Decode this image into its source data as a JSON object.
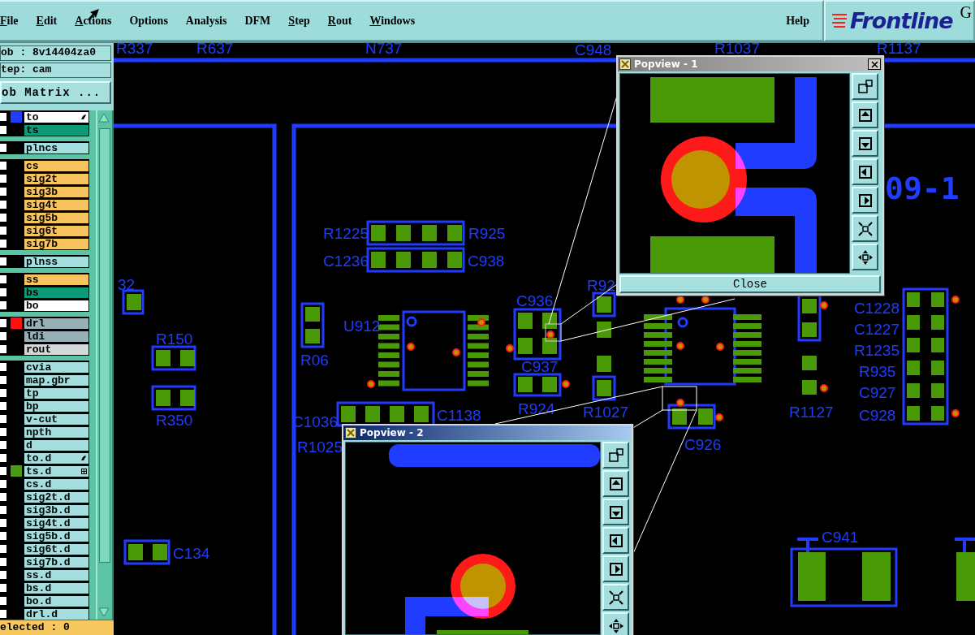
{
  "menu": {
    "items": [
      {
        "label": "File",
        "underlined": true
      },
      {
        "label": "Edit",
        "underlined": true
      },
      {
        "label": "Actions",
        "underlined": true
      },
      {
        "label": "Options",
        "underlined": false
      },
      {
        "label": "Analysis",
        "underlined": false
      },
      {
        "label": "DFM",
        "underlined": false
      },
      {
        "label": "Step",
        "underlined": true
      },
      {
        "label": "Rout",
        "underlined": true
      },
      {
        "label": "Windows",
        "underlined": true
      }
    ],
    "help": "Help"
  },
  "logo": {
    "name": "Frontline",
    "suffix": "G"
  },
  "job_panel": {
    "job": "ob : 8v14404za0",
    "step": "tep: cam",
    "matrix_button": "ob Matrix ...",
    "layer_groups": [
      [
        {
          "name": "to",
          "kind": "silk",
          "color": "#1f3cff",
          "pointer": true,
          "grid": false,
          "checked": false
        },
        {
          "name": "ts",
          "kind": "mask",
          "pointer": false,
          "grid": false,
          "checked": false
        }
      ],
      [
        {
          "name": "plncs",
          "kind": "plane",
          "pointer": false,
          "grid": false,
          "checked": false
        }
      ],
      [
        {
          "name": "cs",
          "kind": "signal",
          "pointer": false,
          "grid": false,
          "checked": false
        },
        {
          "name": "sig2t",
          "kind": "signal",
          "pointer": false,
          "grid": false,
          "checked": false
        },
        {
          "name": "sig3b",
          "kind": "signal",
          "pointer": false,
          "grid": false,
          "checked": false
        },
        {
          "name": "sig4t",
          "kind": "signal",
          "pointer": false,
          "grid": false,
          "checked": false
        },
        {
          "name": "sig5b",
          "kind": "signal",
          "pointer": false,
          "grid": false,
          "checked": false
        },
        {
          "name": "sig6t",
          "kind": "signal",
          "pointer": false,
          "grid": false,
          "checked": false
        },
        {
          "name": "sig7b",
          "kind": "signal",
          "pointer": false,
          "grid": false,
          "checked": false
        }
      ],
      [
        {
          "name": "plnss",
          "kind": "plane",
          "pointer": false,
          "grid": false,
          "checked": false
        }
      ],
      [
        {
          "name": "ss",
          "kind": "signal",
          "pointer": false,
          "grid": false,
          "checked": false
        },
        {
          "name": "bs",
          "kind": "mask",
          "pointer": false,
          "grid": false,
          "checked": false
        },
        {
          "name": "bo",
          "kind": "silk",
          "pointer": false,
          "grid": false,
          "checked": false
        }
      ],
      [
        {
          "name": "drl",
          "kind": "drill",
          "color": "#ff1010",
          "pointer": false,
          "grid": false,
          "checked": false
        },
        {
          "name": "ldi",
          "kind": "drill",
          "pointer": false,
          "grid": false,
          "checked": false
        },
        {
          "name": "rout",
          "kind": "rout",
          "pointer": false,
          "grid": false,
          "checked": false
        }
      ],
      [
        {
          "name": "cvia",
          "kind": "document",
          "pointer": false,
          "grid": false,
          "checked": false
        },
        {
          "name": "map.gbr",
          "kind": "document",
          "pointer": false,
          "grid": false,
          "checked": false
        },
        {
          "name": "tp",
          "kind": "document",
          "pointer": false,
          "grid": false,
          "checked": false
        },
        {
          "name": "bp",
          "kind": "document",
          "pointer": false,
          "grid": false,
          "checked": false
        },
        {
          "name": "v-cut",
          "kind": "document",
          "pointer": false,
          "grid": false,
          "checked": false
        },
        {
          "name": "npth",
          "kind": "document",
          "pointer": false,
          "grid": false,
          "checked": false
        },
        {
          "name": "d",
          "kind": "document",
          "pointer": false,
          "grid": false,
          "checked": false
        },
        {
          "name": "to.d",
          "kind": "document",
          "pointer": true,
          "grid": false,
          "checked": false
        },
        {
          "name": "ts.d",
          "kind": "document",
          "color": "#4a9a10",
          "pointer": false,
          "grid": true,
          "checked": false
        },
        {
          "name": "cs.d",
          "kind": "document",
          "pointer": false,
          "grid": false,
          "checked": false
        },
        {
          "name": "sig2t.d",
          "kind": "document",
          "pointer": false,
          "grid": false,
          "checked": false
        },
        {
          "name": "sig3b.d",
          "kind": "document",
          "pointer": false,
          "grid": false,
          "checked": false
        },
        {
          "name": "sig4t.d",
          "kind": "document",
          "pointer": false,
          "grid": false,
          "checked": false
        },
        {
          "name": "sig5b.d",
          "kind": "document",
          "pointer": false,
          "grid": false,
          "checked": false
        },
        {
          "name": "sig6t.d",
          "kind": "document",
          "pointer": false,
          "grid": false,
          "checked": false
        },
        {
          "name": "sig7b.d",
          "kind": "document",
          "pointer": false,
          "grid": false,
          "checked": false
        },
        {
          "name": "ss.d",
          "kind": "document",
          "pointer": false,
          "grid": false,
          "checked": false
        },
        {
          "name": "bs.d",
          "kind": "document",
          "pointer": false,
          "grid": false,
          "checked": false
        },
        {
          "name": "bo.d",
          "kind": "document",
          "pointer": false,
          "grid": false,
          "checked": false
        },
        {
          "name": "drl.d",
          "kind": "document",
          "pointer": false,
          "grid": false,
          "checked": false
        }
      ]
    ],
    "status": "elected : 0"
  },
  "canvas": {
    "labels": [
      "R337",
      "R637",
      "N737",
      "C948",
      "R1037",
      "R1137",
      "32",
      "R150",
      "R350",
      "C134",
      "R1225",
      "C1236",
      "R925",
      "C938",
      "R06",
      "U912",
      "C936",
      "R92",
      "C937",
      "R924",
      "R1027",
      "C1036",
      "C1138",
      "R1025",
      "C926",
      "R1127",
      "C1228",
      "C1227",
      "R1235",
      "R935",
      "C927",
      "C928",
      "C941"
    ],
    "board_text": "09-1"
  },
  "popviews": [
    {
      "title": "Popview - 1",
      "active": false,
      "close_button": "Close"
    },
    {
      "title": "Popview - 2",
      "active": true
    }
  ]
}
